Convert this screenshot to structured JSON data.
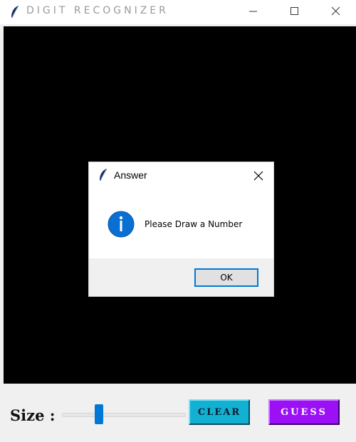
{
  "window": {
    "title": "DIGIT RECOGNIZER",
    "icon": "feather-icon",
    "controls": [
      "minimize-icon",
      "maximize-icon",
      "close-icon"
    ]
  },
  "canvas": {
    "background": "#000000"
  },
  "controls": {
    "size_label": "Size :",
    "slider": {
      "value_fraction": 0.27
    },
    "clear_label": "CLEAR",
    "guess_label": "GUESS",
    "colors": {
      "clear_button": "#12b1d4",
      "guess_button": "#9b10f5",
      "slider_accent": "#0078d7"
    }
  },
  "dialog": {
    "title": "Answer",
    "icon": "info-icon",
    "message": "Please Draw a Number",
    "ok_label": "OK",
    "accent": "#0078d7"
  }
}
